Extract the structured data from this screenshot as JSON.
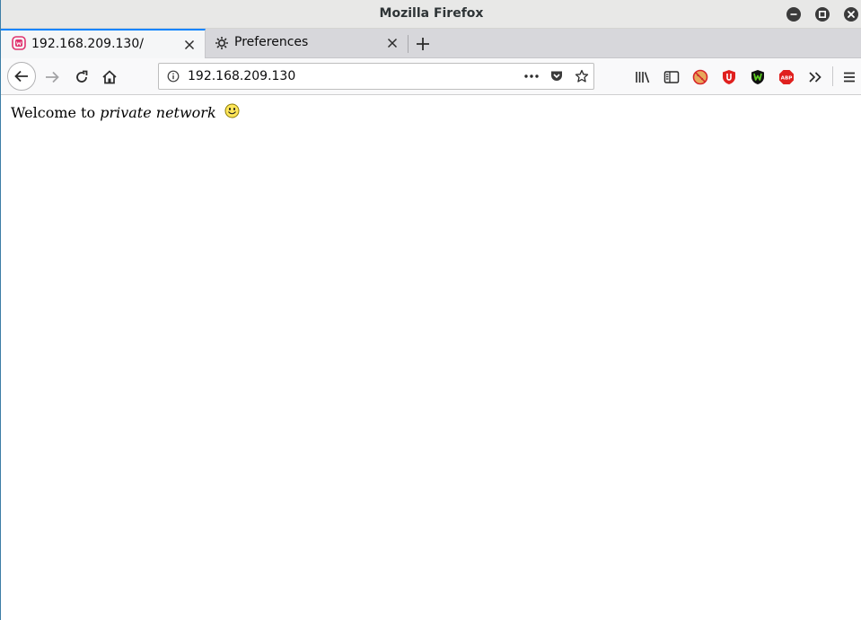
{
  "window": {
    "title": "Mozilla Firefox"
  },
  "tabs": [
    {
      "label": "192.168.209.130/",
      "active": true,
      "icon": "site-favicon-icon"
    },
    {
      "label": "Preferences",
      "active": false,
      "icon": "gear-icon"
    }
  ],
  "navbar": {
    "url": "192.168.209.130"
  },
  "page": {
    "welcome_prefix": "Welcome to ",
    "welcome_emphasis": "private network"
  },
  "colors": {
    "accent": "#0a84ff",
    "favicon": "#e0336f"
  }
}
